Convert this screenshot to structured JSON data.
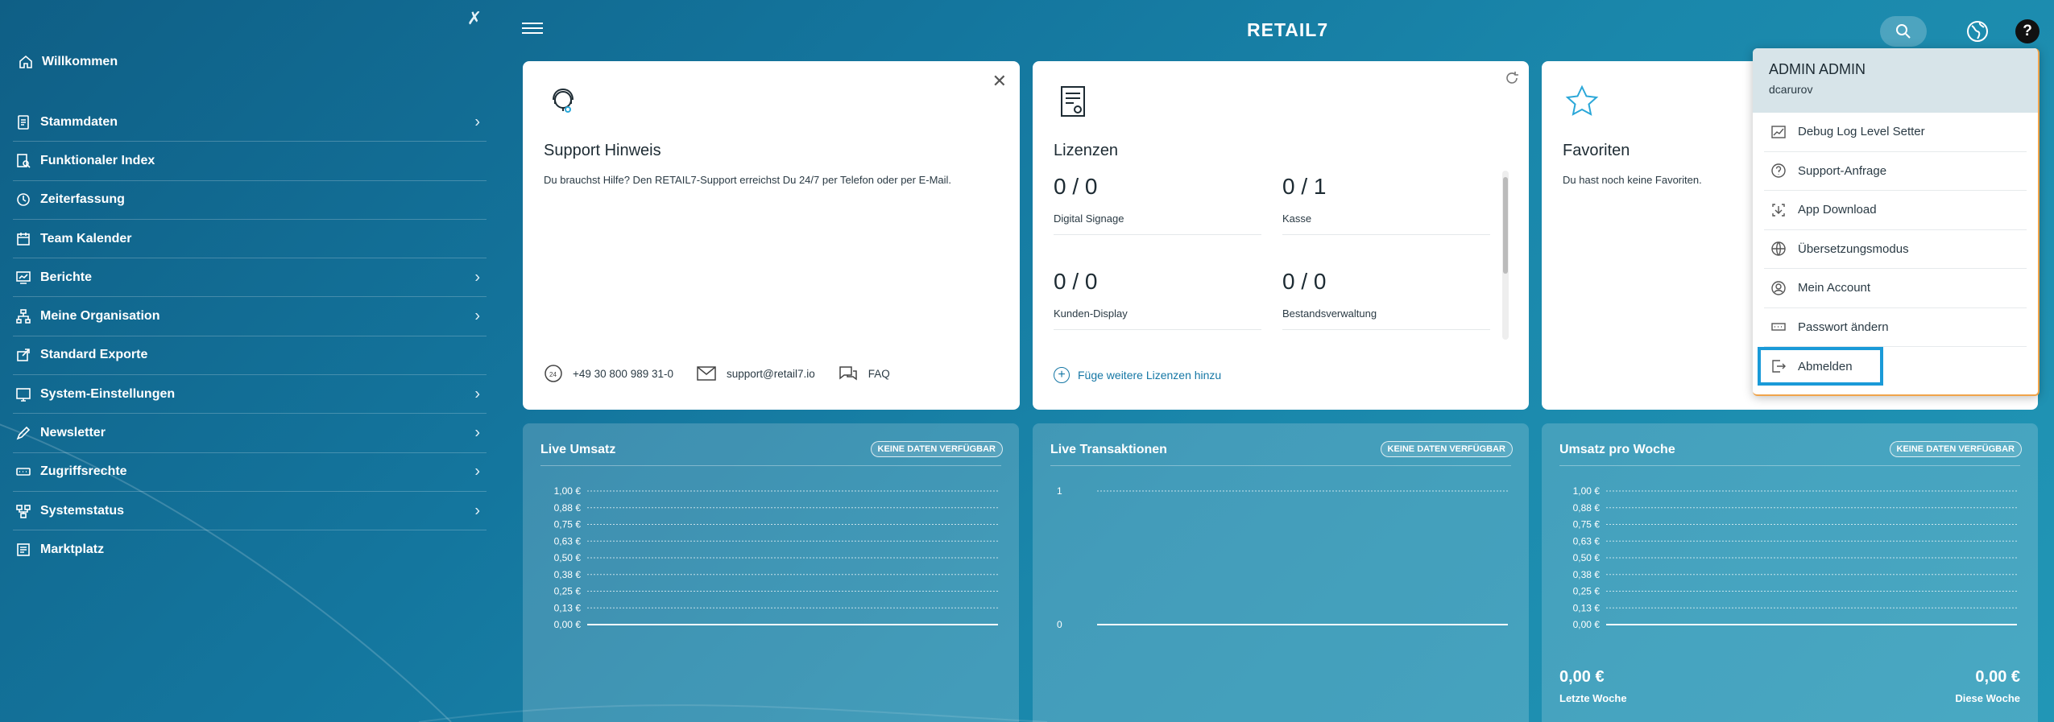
{
  "sidebar": {
    "welcome": "Willkommen",
    "items": [
      {
        "label": "Stammdaten",
        "has_children": true
      },
      {
        "label": "Funktionaler Index",
        "has_children": false
      },
      {
        "label": "Zeiterfassung",
        "has_children": false
      },
      {
        "label": "Team Kalender",
        "has_children": false
      },
      {
        "label": "Berichte",
        "has_children": true
      },
      {
        "label": "Meine Organisation",
        "has_children": true
      },
      {
        "label": "Standard Exporte",
        "has_children": false
      },
      {
        "label": "System-Einstellungen",
        "has_children": true
      },
      {
        "label": "Newsletter",
        "has_children": true
      },
      {
        "label": "Zugriffsrechte",
        "has_children": true
      },
      {
        "label": "Systemstatus",
        "has_children": true
      },
      {
        "label": "Marktplatz",
        "has_children": false
      }
    ]
  },
  "header": {
    "logo": "RETAIL",
    "logo_suffix": "7"
  },
  "support": {
    "title": "Support Hinweis",
    "text": "Du brauchst Hilfe? Den RETAIL7-Support erreichst Du 24/7 per Telefon oder per E-Mail.",
    "phone": "+49 30 800 989 31-0",
    "email": "support@retail7.io",
    "faq": "FAQ"
  },
  "licenses": {
    "title": "Lizenzen",
    "items": [
      {
        "count": "0 / 0",
        "name": "Digital Signage"
      },
      {
        "count": "0 / 1",
        "name": "Kasse"
      },
      {
        "count": "0 / 0",
        "name": "Kunden-Display"
      },
      {
        "count": "0 / 0",
        "name": "Bestandsverwaltung"
      }
    ],
    "add_label": "Füge weitere Lizenzen hinzu"
  },
  "favorites": {
    "title": "Favoriten",
    "text": "Du hast noch keine Favoriten."
  },
  "charts": [
    {
      "title": "Live Umsatz",
      "badge": "KEINE DATEN VERFÜGBAR"
    },
    {
      "title": "Live Transaktionen",
      "badge": "KEINE DATEN VERFÜGBAR"
    },
    {
      "title": "Umsatz pro Woche",
      "badge": "KEINE DATEN VERFÜGBAR",
      "last_week_value": "0,00 €",
      "last_week_label": "Letzte Woche",
      "this_week_value": "0,00 €",
      "this_week_label": "Diese Woche"
    }
  ],
  "chart_data": [
    {
      "type": "line",
      "title": "Live Umsatz",
      "series": [],
      "ylim": [
        0,
        1
      ],
      "yticks": [
        "1,00 €",
        "0,88 €",
        "0,75 €",
        "0,63 €",
        "0,50 €",
        "0,38 €",
        "0,25 €",
        "0,13 €",
        "0,00 €"
      ]
    },
    {
      "type": "line",
      "title": "Live Transaktionen",
      "series": [],
      "ylim": [
        0,
        1
      ],
      "yticks": [
        "1",
        "0"
      ]
    },
    {
      "type": "line",
      "title": "Umsatz pro Woche",
      "series": [],
      "ylim": [
        0,
        1
      ],
      "yticks": [
        "1,00 €",
        "0,88 €",
        "0,75 €",
        "0,63 €",
        "0,50 €",
        "0,38 €",
        "0,25 €",
        "0,13 €",
        "0,00 €"
      ]
    }
  ],
  "user_menu": {
    "name": "ADMIN ADMIN",
    "login": "dcarurov",
    "items": [
      {
        "label": "Debug Log Level Setter",
        "icon": "chart-icon"
      },
      {
        "label": "Support-Anfrage",
        "icon": "question-icon"
      },
      {
        "label": "App Download",
        "icon": "download-icon"
      },
      {
        "label": "Übersetzungsmodus",
        "icon": "globe-icon"
      },
      {
        "label": "Mein Account",
        "icon": "account-icon"
      },
      {
        "label": "Passwort ändern",
        "icon": "password-icon"
      },
      {
        "label": "Abmelden",
        "icon": "logout-icon"
      }
    ]
  }
}
